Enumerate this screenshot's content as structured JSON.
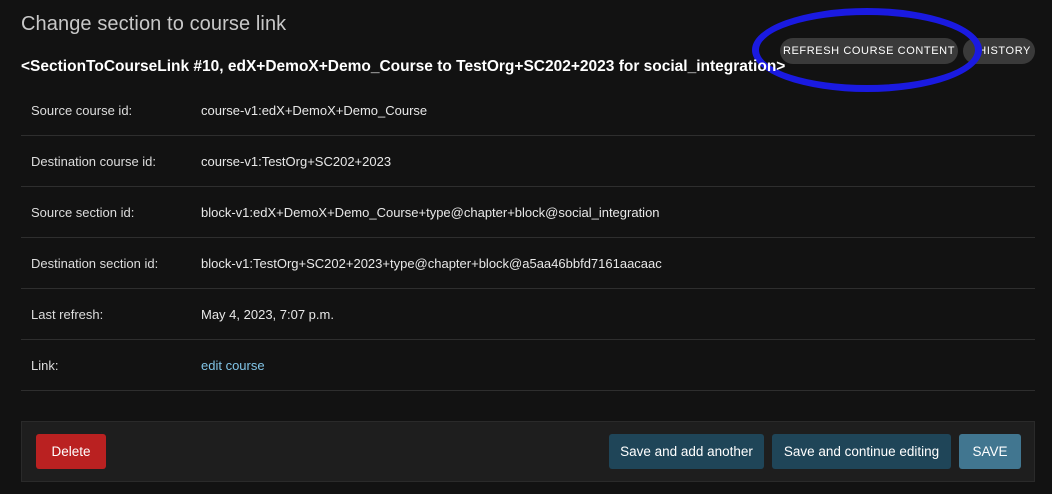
{
  "header": {
    "title": "Change section to course link",
    "object_title": "<SectionToCourseLink #10, edX+DemoX+Demo_Course to TestOrg+SC202+2023 for social_integration>"
  },
  "object_tools": {
    "refresh_label": "REFRESH COURSE CONTENT",
    "history_label": "HISTORY"
  },
  "fields": [
    {
      "label": "Source course id:",
      "value": "course-v1:edX+DemoX+Demo_Course"
    },
    {
      "label": "Destination course id:",
      "value": "course-v1:TestOrg+SC202+2023"
    },
    {
      "label": "Source section id:",
      "value": "block-v1:edX+DemoX+Demo_Course+type@chapter+block@social_integration"
    },
    {
      "label": "Destination section id:",
      "value": "block-v1:TestOrg+SC202+2023+type@chapter+block@a5aa46bbfd7161aacaac"
    },
    {
      "label": "Last refresh:",
      "value": "May 4, 2023, 7:07 p.m."
    },
    {
      "label": "Link:",
      "value": "edit course"
    }
  ],
  "submit": {
    "delete_label": "Delete",
    "save_add_label": "Save and add another",
    "save_continue_label": "Save and continue editing",
    "save_label": "SAVE"
  },
  "colors": {
    "background": "#121212",
    "link": "#81c4e6",
    "delete": "#ba2121",
    "save": "#417690",
    "secondary": "#1f4558",
    "highlight": "#1a1ae0"
  }
}
